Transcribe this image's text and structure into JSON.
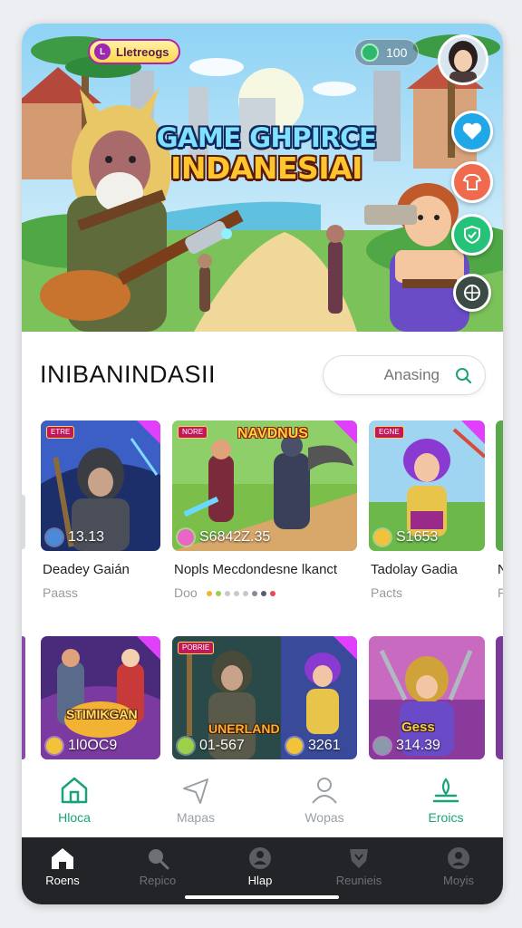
{
  "hero": {
    "language_label": "Lletreogs",
    "coins": "100",
    "title_line1": "GAME GHPIRCE",
    "title_line2": "INDANESIAI",
    "side_buttons": [
      "heart-icon",
      "shirt-icon",
      "shield-icon",
      "globe-icon"
    ]
  },
  "section": {
    "title": "INIBANINDASII",
    "search_placeholder": "Anasing"
  },
  "games_row1": [
    {
      "badge": "ETRE",
      "stat": "13.13",
      "title": "Deadey Gaián",
      "subtitle": "Paass"
    },
    {
      "badge": "NORE",
      "banner": "NAVDNUS",
      "stat": "S6842Z.35",
      "title": "Nopls Mecdondesne lkanct",
      "subtitle": "Doo"
    },
    {
      "badge": "EGNE",
      "stat": "S1653",
      "title": "Tadolay Gadia",
      "subtitle": "Pacts"
    }
  ],
  "games_row2": [
    {
      "badge": "",
      "banner": "STIMIKGAN",
      "stat": "1l0OC9"
    },
    {
      "badge": "POBRIE",
      "banner": "UNERLAND",
      "stat": "01-567",
      "stat2": "3261"
    },
    {
      "badge": "",
      "banner": "Gess",
      "stat": "314.39"
    }
  ],
  "peek_right": {
    "letter1": "N",
    "letter2": "F"
  },
  "tabs": [
    {
      "label": "Hloca",
      "icon": "home-icon",
      "active": true
    },
    {
      "label": "Mapas",
      "icon": "send-icon",
      "active": false
    },
    {
      "label": "Wopas",
      "icon": "user-icon",
      "active": false
    },
    {
      "label": "Eroics",
      "icon": "trophy-icon",
      "active": true
    }
  ],
  "bottom_nav": [
    {
      "label": "Roens",
      "icon": "home-icon",
      "active": true
    },
    {
      "label": "Repico",
      "icon": "search-icon",
      "active": false
    },
    {
      "label": "Hlap",
      "icon": "help-icon",
      "active": true
    },
    {
      "label": "Reunieis",
      "icon": "badge-icon",
      "active": false
    },
    {
      "label": "Moyis",
      "icon": "profile-icon",
      "active": false
    }
  ],
  "colors": {
    "accent_green": "#1aa37a",
    "nav_bg": "#222428",
    "heart_btn": "#1fa7e8",
    "shirt_btn": "#f06a4e",
    "shield_btn": "#27c27a"
  }
}
